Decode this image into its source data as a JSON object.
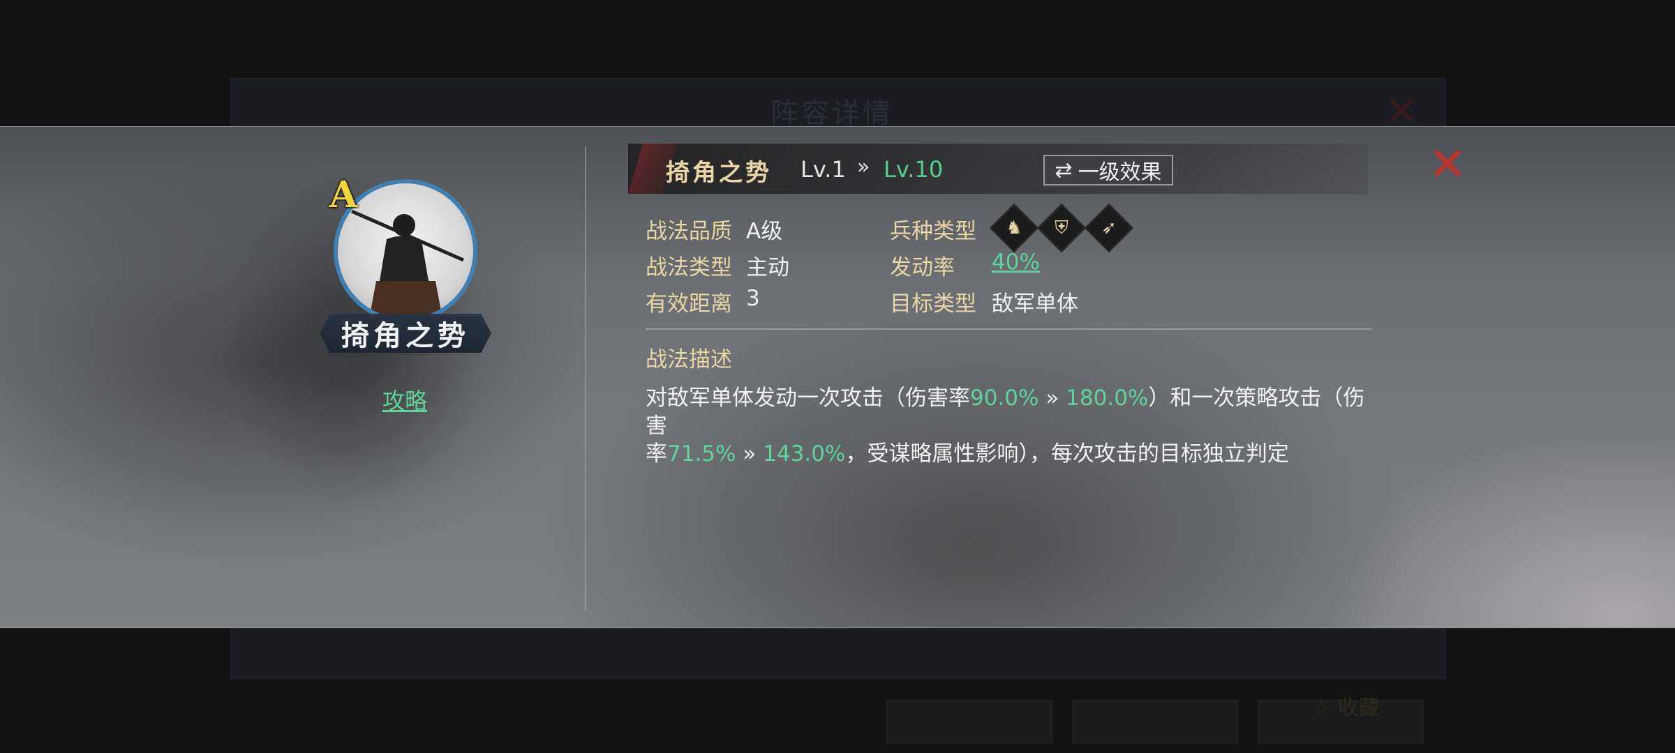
{
  "background": {
    "top_title": "—",
    "window_title": "阵容详情",
    "favorite_label": "收藏"
  },
  "skill": {
    "name": "掎角之势",
    "grade_badge": "A",
    "strategy_link": "攻略",
    "level_current": "Lv.1",
    "level_arrow": "»",
    "level_target": "Lv.10",
    "effect_toggle": {
      "icon": "⇄",
      "label": "一级效果"
    }
  },
  "attributes": {
    "quality": {
      "label": "战法品质",
      "value": "A级"
    },
    "type": {
      "label": "战法类型",
      "value": "主动"
    },
    "range": {
      "label": "有效距离",
      "value": "3"
    },
    "troop": {
      "label": "兵种类型",
      "icons": [
        "cavalry-icon",
        "shield-icon",
        "archer-icon"
      ]
    },
    "rate": {
      "label": "发动率",
      "value": "40%"
    },
    "target": {
      "label": "目标类型",
      "value": "敌军单体"
    }
  },
  "description": {
    "heading": "战法描述",
    "line1_a": "对敌军单体发动一次攻击（伤害率",
    "line1_g1": "90.0%",
    "line1_arrow": " » ",
    "line1_g2": "180.0%",
    "line1_b": "）和一次策略攻击（伤害",
    "line2_a": "率",
    "line2_g1": "71.5%",
    "line2_arrow": " » ",
    "line2_g2": "143.0%",
    "line2_b": "，受谋略属性影响），每次攻击的目标独立判定"
  },
  "colors": {
    "gold_label": "#e9d6a6",
    "green_value": "#5fd49a",
    "close_red": "#c0342f",
    "ring_blue": "#3f7fb2"
  }
}
